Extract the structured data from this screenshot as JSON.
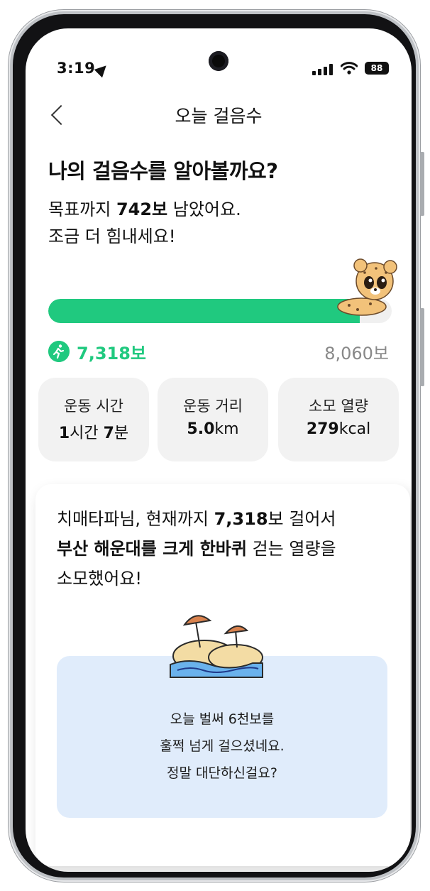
{
  "status_bar": {
    "time": "3:19",
    "battery": "88",
    "icons": [
      "location-arrow-icon",
      "cellular-signal-icon",
      "wifi-icon",
      "battery-icon"
    ]
  },
  "header": {
    "title": "오늘 걸음수",
    "back_icon": "back-chevron-icon"
  },
  "intro": {
    "headline": "나의 걸음수를 알아볼까요?",
    "line1_prefix": "목표까지 ",
    "line1_bold": "742보",
    "line1_suffix": " 남았어요.",
    "line2": "조금 더 힘내세요!"
  },
  "progress": {
    "current_steps": "7,318보",
    "goal_steps": "8,060보",
    "fraction": 0.908,
    "fill_color": "#20c97f",
    "mascot_icon": "cheetah-mascot-icon",
    "run_icon": "running-icon"
  },
  "stats": [
    {
      "label": "운동 시간",
      "value_parts": [
        {
          "t": "1",
          "b": true
        },
        {
          "t": "시간 ",
          "b": false
        },
        {
          "t": "7",
          "b": true
        },
        {
          "t": "분",
          "b": false
        }
      ]
    },
    {
      "label": "운동 거리",
      "value_parts": [
        {
          "t": "5.0",
          "b": true
        },
        {
          "t": "km",
          "b": false
        }
      ]
    },
    {
      "label": "소모 열량",
      "value_parts": [
        {
          "t": "279",
          "b": true
        },
        {
          "t": "kcal",
          "b": false
        }
      ]
    }
  ],
  "message": {
    "part1": "치매타파님, 현재까지 ",
    "part1_bold": "7,318",
    "part2": "보 걸어서",
    "part3_bold": "부산 해운대를 크게 한바퀴",
    "part4": " 걷는 열량을",
    "part5": "소모했어요!",
    "beach_icon": "beach-umbrella-icon",
    "info_line1": "오늘 벌써 6천보를",
    "info_line2": "훌쩍 넘게 걸으셨네요.",
    "info_line3": "정말 대단하신걸요?"
  }
}
